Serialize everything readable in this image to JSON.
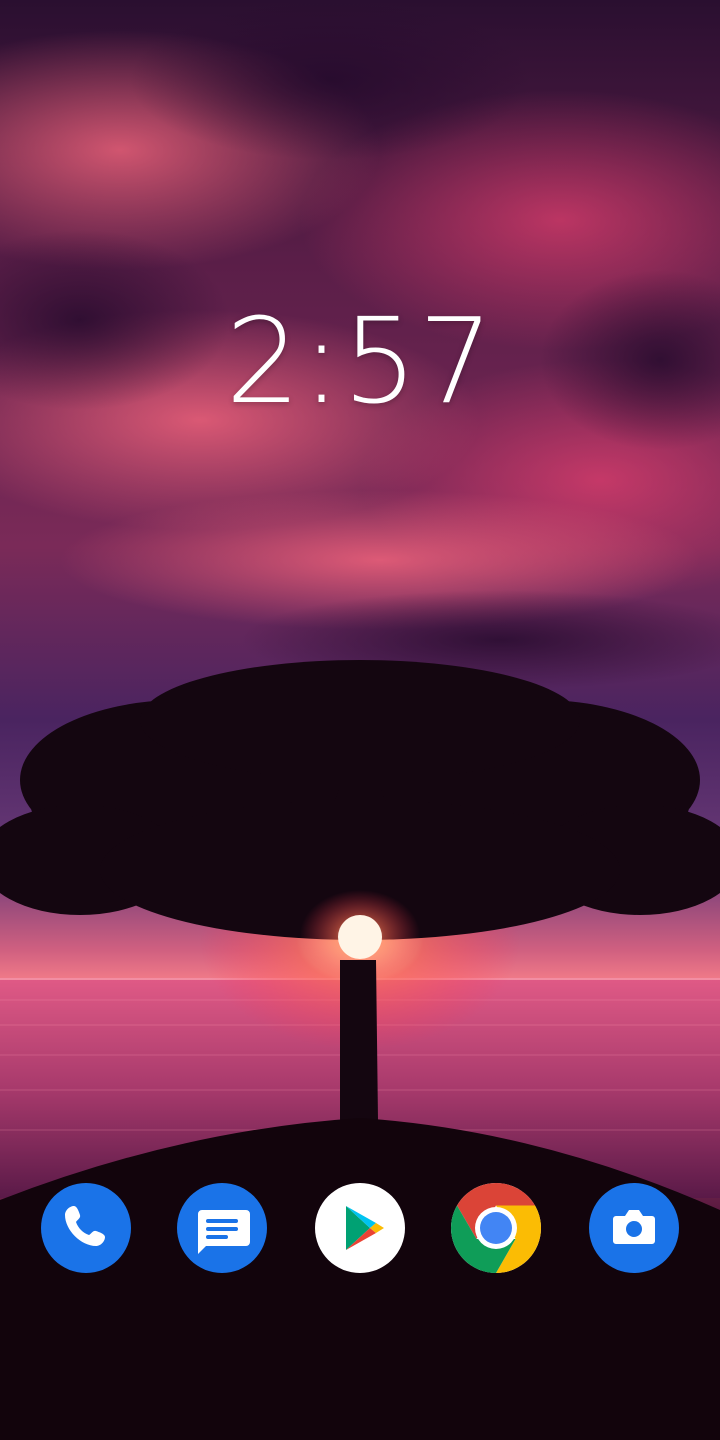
{
  "lock_screen": {
    "clock": {
      "time": "2:57"
    }
  },
  "wallpaper": {
    "icon": "tree-sunset-wallpaper",
    "colors": {
      "sky_top": "#3a1540",
      "cloud": "#d84868",
      "horizon": "#f0607a",
      "sea": "#b8406a",
      "silhouette": "#140610"
    }
  },
  "dock": {
    "apps": [
      {
        "id": "phone",
        "icon": "phone-icon",
        "color": "#1a73e8"
      },
      {
        "id": "messages",
        "icon": "messages-icon",
        "color": "#1a73e8"
      },
      {
        "id": "play-store",
        "icon": "play-store-icon",
        "color": "#ffffff"
      },
      {
        "id": "chrome",
        "icon": "chrome-icon",
        "color": "#4285f4"
      },
      {
        "id": "camera",
        "icon": "camera-icon",
        "color": "#1a73e8"
      }
    ]
  }
}
